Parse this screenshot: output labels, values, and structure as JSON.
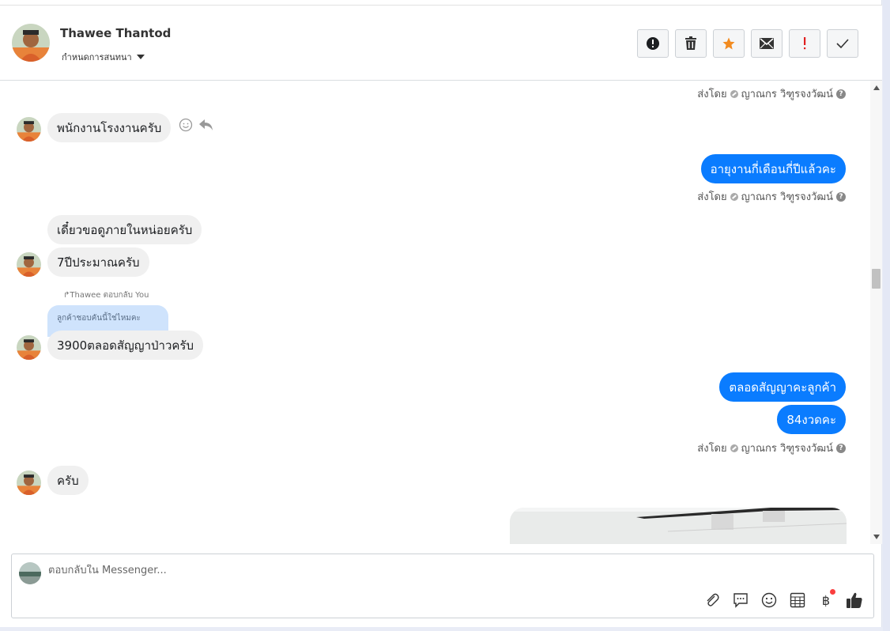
{
  "header": {
    "name": "Thawee Thantod",
    "subtitle": "กำหนดการสนทนา",
    "tools": [
      {
        "icon": "alert-circle-icon",
        "color": "#333333"
      },
      {
        "icon": "trash-icon",
        "color": "#333333"
      },
      {
        "icon": "star-icon",
        "color": "#f28b20"
      },
      {
        "icon": "envelope-icon",
        "color": "#333333"
      },
      {
        "icon": "exclamation-icon",
        "color": "#e02020"
      },
      {
        "icon": "check-icon",
        "color": "#333333"
      }
    ]
  },
  "sent_by": {
    "prefix": "ส่งโดย",
    "agent": "ญาณกร วิฑูรจงวัฒน์",
    "help": "?"
  },
  "messages": [
    {
      "from": "customer",
      "text": "พนักงานโรงงานครับ"
    },
    {
      "from": "agent",
      "text": "อายุงานกี่เดือนกี่ปีแล้วคะ"
    },
    {
      "from": "customer",
      "text": "เดี๋ยวขอดูภายในหน่อยครับ"
    },
    {
      "from": "customer",
      "text": "7ปีประมาณครับ"
    },
    {
      "from": "customer",
      "text": "3900ตลอดสัญญาป่าวครับ",
      "reply_to": "Thawee ตอบกลับ You",
      "quoted": "ลูกค้าชอบคันนี้ใช่ไหมคะ"
    },
    {
      "from": "agent",
      "text": "ตลอดสัญญาคะลูกค้า"
    },
    {
      "from": "agent",
      "text": "84งวดคะ"
    },
    {
      "from": "customer",
      "text": "ครับ"
    }
  ],
  "composer": {
    "placeholder": "ตอบกลับใน Messenger...",
    "tools": [
      "paperclip-icon",
      "speech-bubble-icon",
      "smiley-icon",
      "table-icon",
      "baht-icon",
      "thumbs-up-icon"
    ],
    "baht_symbol": "฿",
    "like_color": "#333333"
  },
  "colors": {
    "outgoing_bubble": "#0a7cff",
    "incoming_bubble": "#f0f0f0",
    "accent_star": "#f28b20"
  }
}
